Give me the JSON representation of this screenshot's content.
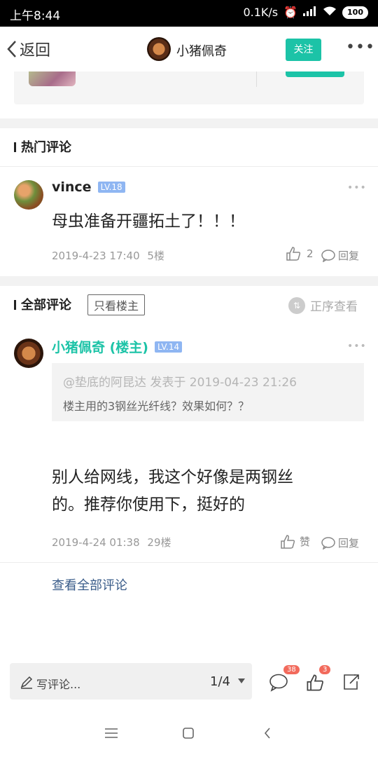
{
  "status_bar": {
    "time": "上午8:44",
    "speed": "0.1K/s",
    "battery": "100"
  },
  "nav": {
    "back_label": "返回",
    "title": "小猪佩奇",
    "follow_label": "关注"
  },
  "hot_section": {
    "title": "热门评论",
    "comment": {
      "user": "vince",
      "level": "LV.18",
      "content": "母虫准备开疆拓土了！！！",
      "time": "2019-4-23 17:40",
      "floor": "5楼",
      "likes": "2",
      "reply_label": "回复"
    }
  },
  "all_section": {
    "title": "全部评论",
    "filter_label": "只看楼主",
    "sort_label": "正序查看",
    "comment": {
      "user": "小猪佩奇 (楼主)",
      "level": "LV.14",
      "quote_header": "@垫底的阿昆达 发表于 2019-04-23 21:26",
      "quote_text": "楼主用的3钢丝光纤线？效果如何？？",
      "content_line1": "别人给网线，我这个好像是两钢丝",
      "content_line2": "的。推荐你使用下，挺好的",
      "time": "2019-4-24 01:38",
      "floor": "29楼",
      "like_label": "赞",
      "reply_label": "回复"
    },
    "view_all_label": "查看全部评论"
  },
  "bottom_bar": {
    "write_placeholder": "写评论...",
    "page_indicator": "1/4",
    "comment_badge": "38",
    "like_badge": "3"
  },
  "colors": {
    "accent": "#1cc3a7",
    "level_badge": "#8fb6f2",
    "notification": "#f26a5c"
  }
}
